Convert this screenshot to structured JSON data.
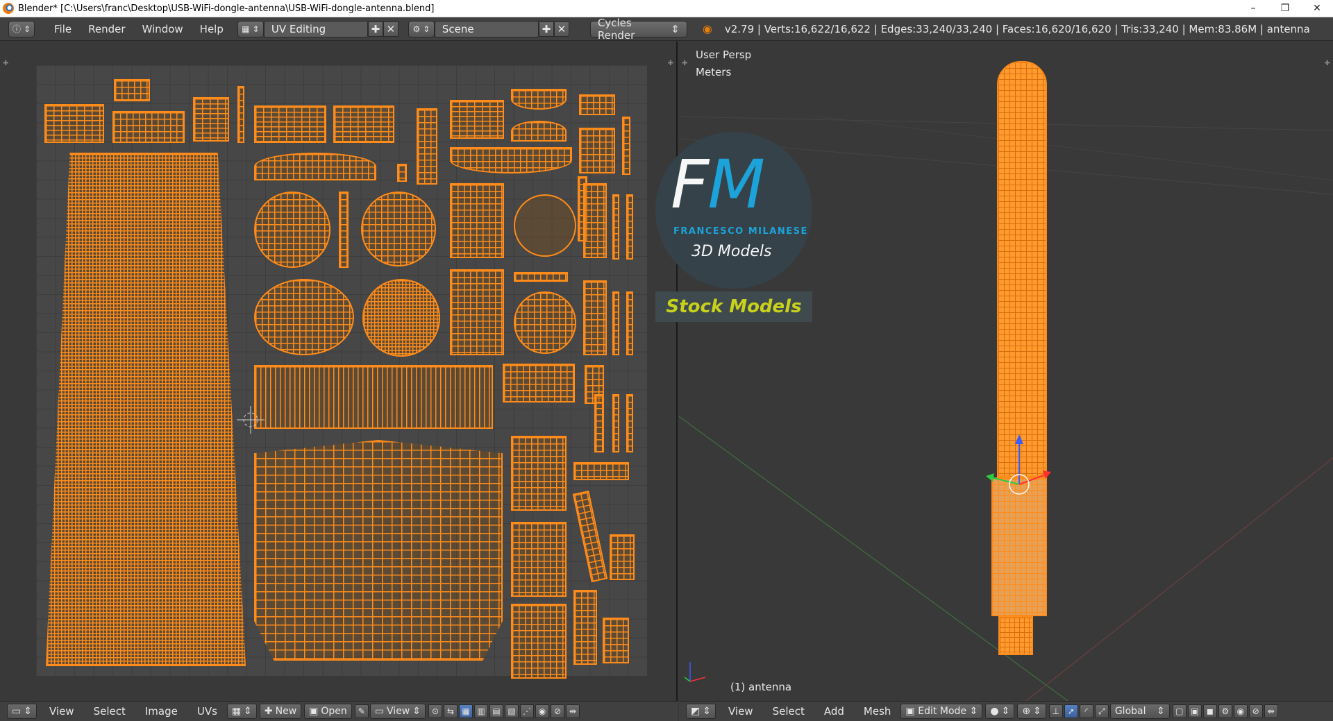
{
  "window": {
    "title": "Blender* [C:\\Users\\franc\\Desktop\\USB-WiFi-dongle-antenna\\USB-WiFi-dongle-antenna.blend]",
    "minimize": "–",
    "maximize": "❐",
    "close": "✕"
  },
  "topbar": {
    "menus": [
      "File",
      "Render",
      "Window",
      "Help"
    ],
    "screen_layout": "UV Editing",
    "scene": "Scene",
    "render_engine": "Cycles Render",
    "stats": "v2.79 | Verts:16,622/16,622 | Edges:33,240/33,240 | Faces:16,620/16,620 | Tris:33,240 | Mem:83.86M | antenna"
  },
  "viewport": {
    "view_name": "User Persp",
    "units": "Meters",
    "object_label": "(1) antenna"
  },
  "watermark": {
    "letter_f": "F",
    "letter_m": "M",
    "brand": "FRANCESCO MILANESE",
    "subtitle": "3D Models",
    "banner": "Stock Models"
  },
  "uv_bottom": {
    "view": "View",
    "select": "Select",
    "image": "Image",
    "uvs": "UVs",
    "new": "New",
    "open": "Open",
    "view2": "View"
  },
  "vp_bottom": {
    "view": "View",
    "select": "Select",
    "add": "Add",
    "mesh": "Mesh",
    "mode": "Edit Mode",
    "orientation": "Global"
  },
  "colors": {
    "accent": "#ff8c1a",
    "background": "#393939",
    "header": "#404040",
    "logo_blue": "#1ba8e0",
    "stock_yellow": "#c8d21a"
  }
}
